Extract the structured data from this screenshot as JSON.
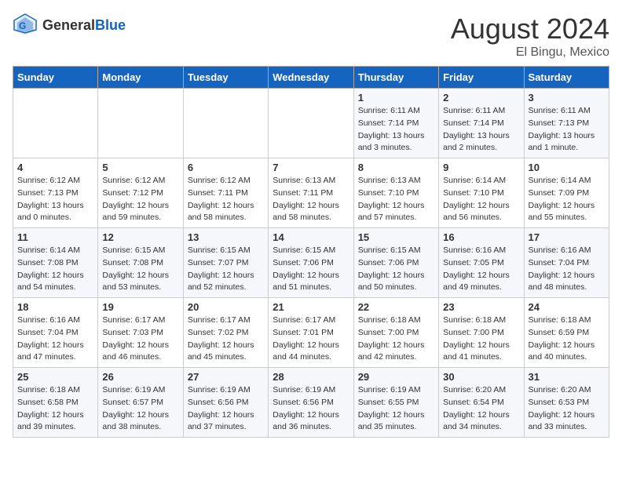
{
  "header": {
    "logo_general": "General",
    "logo_blue": "Blue",
    "month_year": "August 2024",
    "location": "El Bingu, Mexico"
  },
  "days_of_week": [
    "Sunday",
    "Monday",
    "Tuesday",
    "Wednesday",
    "Thursday",
    "Friday",
    "Saturday"
  ],
  "weeks": [
    [
      {
        "day": "",
        "sunrise": "",
        "sunset": "",
        "daylight": ""
      },
      {
        "day": "",
        "sunrise": "",
        "sunset": "",
        "daylight": ""
      },
      {
        "day": "",
        "sunrise": "",
        "sunset": "",
        "daylight": ""
      },
      {
        "day": "",
        "sunrise": "",
        "sunset": "",
        "daylight": ""
      },
      {
        "day": "1",
        "sunrise": "Sunrise: 6:11 AM",
        "sunset": "Sunset: 7:14 PM",
        "daylight": "Daylight: 13 hours and 3 minutes."
      },
      {
        "day": "2",
        "sunrise": "Sunrise: 6:11 AM",
        "sunset": "Sunset: 7:14 PM",
        "daylight": "Daylight: 13 hours and 2 minutes."
      },
      {
        "day": "3",
        "sunrise": "Sunrise: 6:11 AM",
        "sunset": "Sunset: 7:13 PM",
        "daylight": "Daylight: 13 hours and 1 minute."
      }
    ],
    [
      {
        "day": "4",
        "sunrise": "Sunrise: 6:12 AM",
        "sunset": "Sunset: 7:13 PM",
        "daylight": "Daylight: 13 hours and 0 minutes."
      },
      {
        "day": "5",
        "sunrise": "Sunrise: 6:12 AM",
        "sunset": "Sunset: 7:12 PM",
        "daylight": "Daylight: 12 hours and 59 minutes."
      },
      {
        "day": "6",
        "sunrise": "Sunrise: 6:12 AM",
        "sunset": "Sunset: 7:11 PM",
        "daylight": "Daylight: 12 hours and 58 minutes."
      },
      {
        "day": "7",
        "sunrise": "Sunrise: 6:13 AM",
        "sunset": "Sunset: 7:11 PM",
        "daylight": "Daylight: 12 hours and 58 minutes."
      },
      {
        "day": "8",
        "sunrise": "Sunrise: 6:13 AM",
        "sunset": "Sunset: 7:10 PM",
        "daylight": "Daylight: 12 hours and 57 minutes."
      },
      {
        "day": "9",
        "sunrise": "Sunrise: 6:14 AM",
        "sunset": "Sunset: 7:10 PM",
        "daylight": "Daylight: 12 hours and 56 minutes."
      },
      {
        "day": "10",
        "sunrise": "Sunrise: 6:14 AM",
        "sunset": "Sunset: 7:09 PM",
        "daylight": "Daylight: 12 hours and 55 minutes."
      }
    ],
    [
      {
        "day": "11",
        "sunrise": "Sunrise: 6:14 AM",
        "sunset": "Sunset: 7:08 PM",
        "daylight": "Daylight: 12 hours and 54 minutes."
      },
      {
        "day": "12",
        "sunrise": "Sunrise: 6:15 AM",
        "sunset": "Sunset: 7:08 PM",
        "daylight": "Daylight: 12 hours and 53 minutes."
      },
      {
        "day": "13",
        "sunrise": "Sunrise: 6:15 AM",
        "sunset": "Sunset: 7:07 PM",
        "daylight": "Daylight: 12 hours and 52 minutes."
      },
      {
        "day": "14",
        "sunrise": "Sunrise: 6:15 AM",
        "sunset": "Sunset: 7:06 PM",
        "daylight": "Daylight: 12 hours and 51 minutes."
      },
      {
        "day": "15",
        "sunrise": "Sunrise: 6:15 AM",
        "sunset": "Sunset: 7:06 PM",
        "daylight": "Daylight: 12 hours and 50 minutes."
      },
      {
        "day": "16",
        "sunrise": "Sunrise: 6:16 AM",
        "sunset": "Sunset: 7:05 PM",
        "daylight": "Daylight: 12 hours and 49 minutes."
      },
      {
        "day": "17",
        "sunrise": "Sunrise: 6:16 AM",
        "sunset": "Sunset: 7:04 PM",
        "daylight": "Daylight: 12 hours and 48 minutes."
      }
    ],
    [
      {
        "day": "18",
        "sunrise": "Sunrise: 6:16 AM",
        "sunset": "Sunset: 7:04 PM",
        "daylight": "Daylight: 12 hours and 47 minutes."
      },
      {
        "day": "19",
        "sunrise": "Sunrise: 6:17 AM",
        "sunset": "Sunset: 7:03 PM",
        "daylight": "Daylight: 12 hours and 46 minutes."
      },
      {
        "day": "20",
        "sunrise": "Sunrise: 6:17 AM",
        "sunset": "Sunset: 7:02 PM",
        "daylight": "Daylight: 12 hours and 45 minutes."
      },
      {
        "day": "21",
        "sunrise": "Sunrise: 6:17 AM",
        "sunset": "Sunset: 7:01 PM",
        "daylight": "Daylight: 12 hours and 44 minutes."
      },
      {
        "day": "22",
        "sunrise": "Sunrise: 6:18 AM",
        "sunset": "Sunset: 7:00 PM",
        "daylight": "Daylight: 12 hours and 42 minutes."
      },
      {
        "day": "23",
        "sunrise": "Sunrise: 6:18 AM",
        "sunset": "Sunset: 7:00 PM",
        "daylight": "Daylight: 12 hours and 41 minutes."
      },
      {
        "day": "24",
        "sunrise": "Sunrise: 6:18 AM",
        "sunset": "Sunset: 6:59 PM",
        "daylight": "Daylight: 12 hours and 40 minutes."
      }
    ],
    [
      {
        "day": "25",
        "sunrise": "Sunrise: 6:18 AM",
        "sunset": "Sunset: 6:58 PM",
        "daylight": "Daylight: 12 hours and 39 minutes."
      },
      {
        "day": "26",
        "sunrise": "Sunrise: 6:19 AM",
        "sunset": "Sunset: 6:57 PM",
        "daylight": "Daylight: 12 hours and 38 minutes."
      },
      {
        "day": "27",
        "sunrise": "Sunrise: 6:19 AM",
        "sunset": "Sunset: 6:56 PM",
        "daylight": "Daylight: 12 hours and 37 minutes."
      },
      {
        "day": "28",
        "sunrise": "Sunrise: 6:19 AM",
        "sunset": "Sunset: 6:56 PM",
        "daylight": "Daylight: 12 hours and 36 minutes."
      },
      {
        "day": "29",
        "sunrise": "Sunrise: 6:19 AM",
        "sunset": "Sunset: 6:55 PM",
        "daylight": "Daylight: 12 hours and 35 minutes."
      },
      {
        "day": "30",
        "sunrise": "Sunrise: 6:20 AM",
        "sunset": "Sunset: 6:54 PM",
        "daylight": "Daylight: 12 hours and 34 minutes."
      },
      {
        "day": "31",
        "sunrise": "Sunrise: 6:20 AM",
        "sunset": "Sunset: 6:53 PM",
        "daylight": "Daylight: 12 hours and 33 minutes."
      }
    ]
  ]
}
